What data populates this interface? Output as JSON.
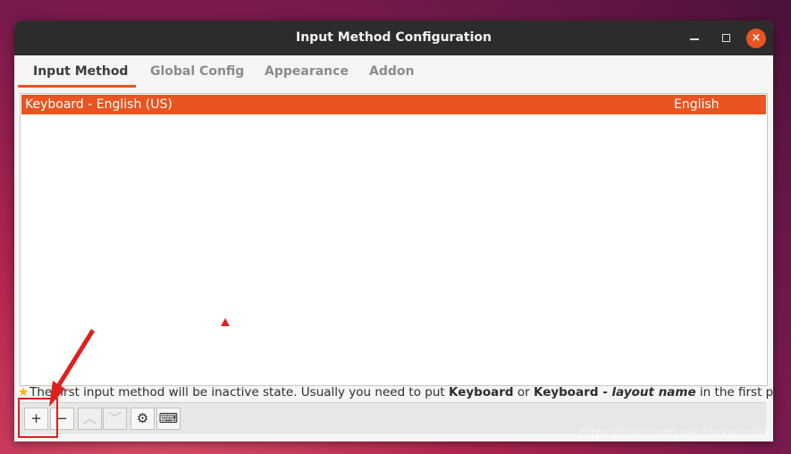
{
  "window": {
    "title": "Input Method Configuration",
    "controls": {
      "minimize_icon": "window-minimize-icon",
      "maximize_icon": "window-maximize-icon",
      "close_icon": "window-close-icon",
      "close_glyph": "×"
    }
  },
  "tabs": [
    {
      "label": "Input Method",
      "active": true
    },
    {
      "label": "Global Config",
      "active": false
    },
    {
      "label": "Appearance",
      "active": false
    },
    {
      "label": "Addon",
      "active": false
    }
  ],
  "input_methods": {
    "rows": [
      {
        "name": "Keyboard - English (US)",
        "language": "English",
        "selected": true
      }
    ]
  },
  "hint": {
    "icon": "star-icon",
    "text_before": "The first input method will be inactive state. Usually you need to put ",
    "bold_1": "Keyboard",
    "middle": " or ",
    "bold_2": "Keyboard - ",
    "italic": "layout name",
    "text_after": " in the first place."
  },
  "toolbar": {
    "add_glyph": "+",
    "remove_glyph": "−",
    "up_glyph": "︿",
    "down_glyph": "﹀",
    "configure_glyph": "⚙",
    "keyboard_glyph": "⌨"
  },
  "watermark": "https://blog.csdn.net/lookwind09",
  "colors": {
    "accent": "#e95420",
    "titlebar": "#2c2c2c",
    "annotation_red": "#e0201e"
  }
}
